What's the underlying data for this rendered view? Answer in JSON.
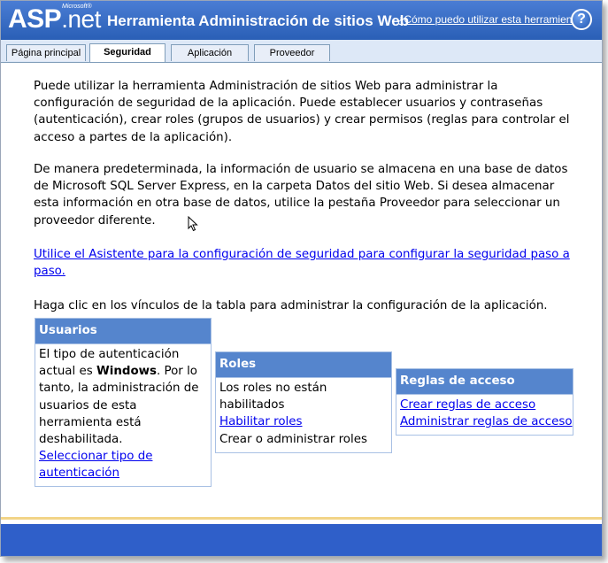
{
  "header": {
    "logo_main": "ASP",
    "logo_net": ".net",
    "logo_microsoft": "Microsoft®",
    "title": "Herramienta Administración de sitios Web",
    "help_link": "¿Cómo puedo utilizar esta herramienta?",
    "help_icon": "?"
  },
  "tabs": [
    {
      "label": "Página principal",
      "active": false
    },
    {
      "label": "Seguridad",
      "active": true
    },
    {
      "label": "Aplicación",
      "active": false
    },
    {
      "label": "Proveedor",
      "active": false
    }
  ],
  "main": {
    "intro": "Puede utilizar la herramienta Administración de sitios Web para administrar la configuración de seguridad de la aplicación. Puede establecer usuarios y contraseñas (autenticación), crear roles (grupos de usuarios) y crear permisos (reglas para controlar el acceso a partes de la aplicación).",
    "default_note": "De manera predeterminada, la información de usuario se almacena en una base de datos de Microsoft SQL Server Express, en la carpeta Datos del sitio Web. Si desea almacenar esta información en otra base de datos, utilice la pestaña Proveedor para seleccionar un proveedor diferente.",
    "wizard_link": "Utilice el Asistente para la configuración de seguridad para configurar la seguridad paso a paso.",
    "table_intro": "Haga clic en los vínculos de la tabla para administrar la configuración de la aplicación."
  },
  "panels": {
    "users": {
      "title": "Usuarios",
      "text_line1": "El tipo de autenticación",
      "text_line2_pre": "actual es ",
      "text_line2_bold": "Windows",
      "text_line2_post": ". Por lo",
      "text_line3": "tanto, la administración de",
      "text_line4": "usuarios de esta",
      "text_line5": "herramienta está",
      "text_line6": "deshabilitada.",
      "link_line1": "Seleccionar tipo de",
      "link_line2": "autenticación"
    },
    "roles": {
      "title": "Roles",
      "text_line1": "Los roles no están",
      "text_line2": "habilitados",
      "link": "Habilitar roles",
      "text_line3": "Crear o administrar roles"
    },
    "access": {
      "title": "Reglas de acceso",
      "link1": "Crear reglas de acceso",
      "link2": "Administrar reglas de acceso"
    }
  },
  "colors": {
    "header": "#2a5fb6",
    "panel_header": "#5585cd",
    "footer": "#2f5fc9",
    "footer_line": "#f2d487",
    "link": "#0000ee"
  }
}
